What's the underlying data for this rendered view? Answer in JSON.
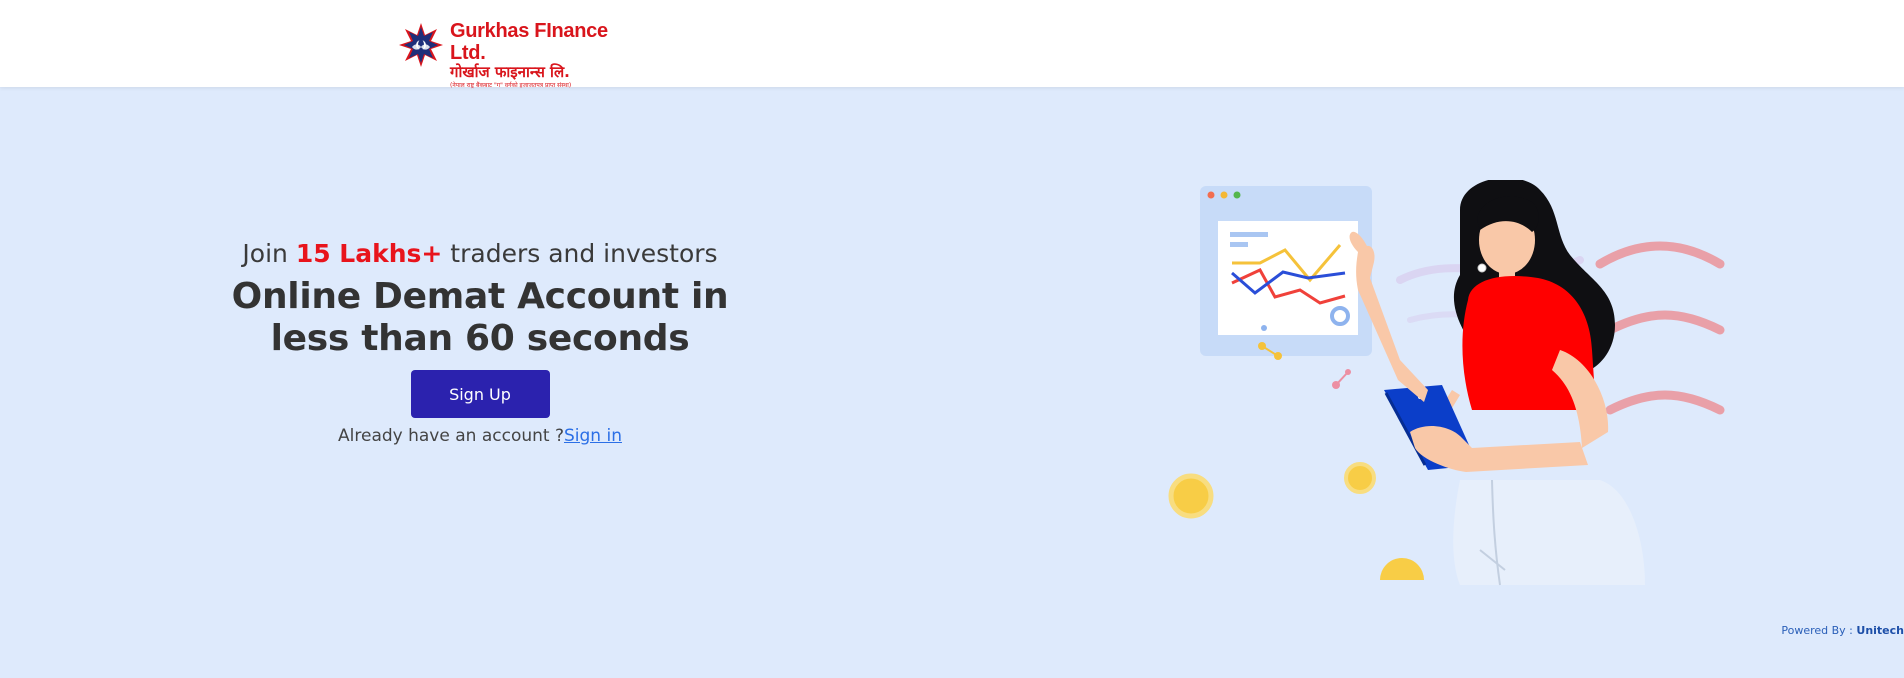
{
  "brand": {
    "name_en": "Gurkhas FInance Ltd.",
    "name_np": "गोर्खाज फाइनान्स लि.",
    "tagline_np": "(नेपाल राष्ट्र बैंकबाट \"ग\" वर्गको इजाजतपत्र प्राप्त संस्था)",
    "logo_icon": "lotus-star-icon",
    "colors": {
      "brand_red": "#d9151c",
      "brand_navy": "#1f2f7a"
    }
  },
  "hero": {
    "tagline_prefix": "Join ",
    "tagline_highlight": "15 Lakhs+",
    "tagline_suffix": " traders and investors",
    "headline_line1": "Online Demat Account in",
    "headline_line2": "less than 60 seconds",
    "signup_label": "Sign Up",
    "account_prompt": "Already have an account ?",
    "signin_label": "Sign in",
    "colors": {
      "button": "#2b22ae",
      "highlight": "#e8141c",
      "link": "#2b6fe6"
    }
  },
  "illustration": {
    "icon": "woman-with-chart-illustration"
  },
  "footer": {
    "powered_prefix": "Powered By : ",
    "powered_brand": "Unitech"
  },
  "page": {
    "background": "#deeafc"
  }
}
